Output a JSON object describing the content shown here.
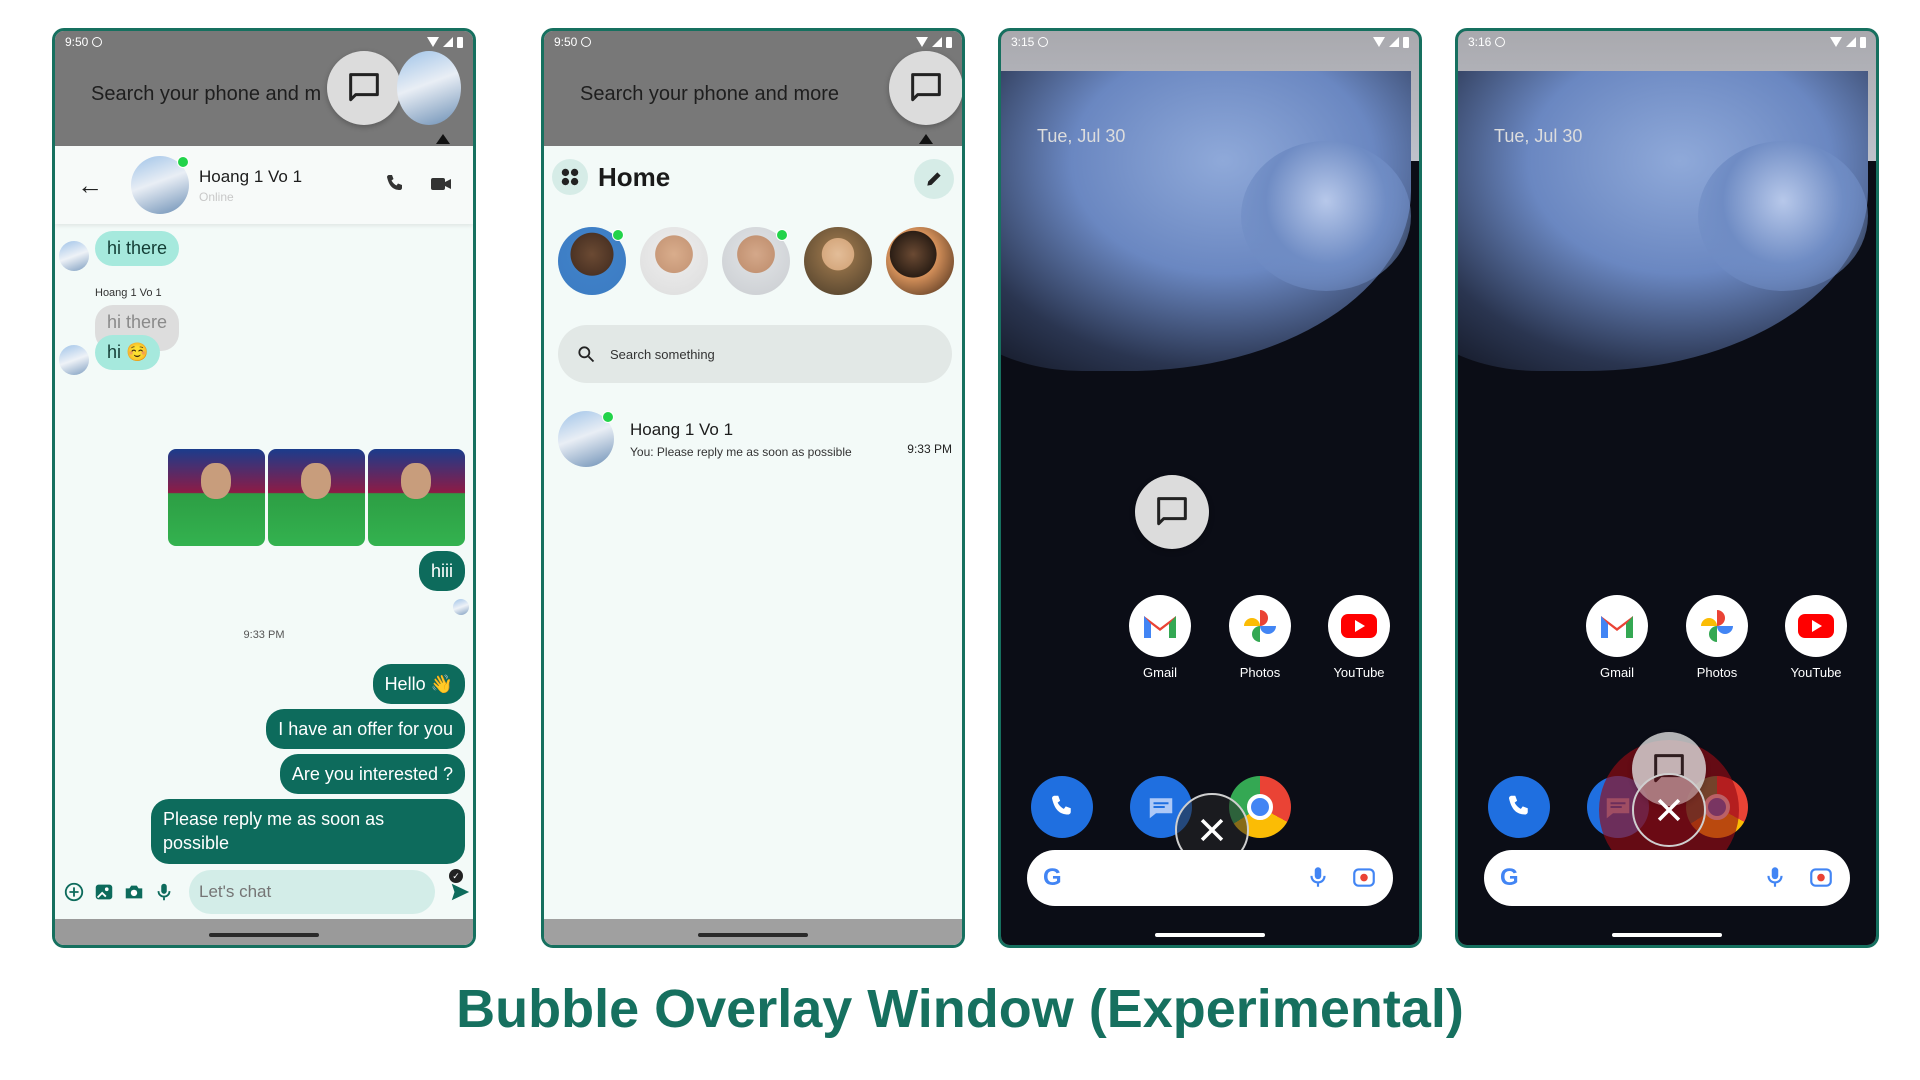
{
  "caption": "Bubble Overlay Window (Experimental)",
  "phone1": {
    "status_time": "9:50",
    "top_search": "Search your phone and m",
    "contact_name": "Hoang 1 Vo 1",
    "contact_status": "Online",
    "sender_label": "Hoang 1 Vo 1",
    "msg_hi_there_1": "hi there",
    "msg_hi_there_2": "hi there",
    "msg_hi": "hi ☺️",
    "msg_hiii": "hiii",
    "time_sep": "9:33 PM",
    "out_hello": "Hello 👋",
    "out_offer": "I have an offer for you",
    "out_interested": "Are you interested ?",
    "out_reply": "Please reply me as soon as possible",
    "composer_placeholder": "Let's chat"
  },
  "phone2": {
    "status_time": "9:50",
    "top_search": "Search your phone and more",
    "home_title": "Home",
    "search_placeholder": "Search something",
    "conv_name": "Hoang 1 Vo 1",
    "conv_preview": "You: Please reply me as soon as possible",
    "conv_time": "9:33 PM"
  },
  "phone3": {
    "status_time": "3:15",
    "date": "Tue, Jul 30",
    "apps": [
      {
        "label": "Gmail",
        "icon": "gmail-icon"
      },
      {
        "label": "Photos",
        "icon": "photos-icon"
      },
      {
        "label": "YouTube",
        "icon": "youtube-icon"
      }
    ]
  },
  "phone4": {
    "status_time": "3:16",
    "date": "Tue, Jul 30",
    "apps": [
      {
        "label": "Gmail",
        "icon": "gmail-icon"
      },
      {
        "label": "Photos",
        "icon": "photos-icon"
      },
      {
        "label": "YouTube",
        "icon": "youtube-icon"
      }
    ]
  },
  "colors": {
    "accent": "#16705f",
    "bubble_in": "#a6e9dd",
    "bubble_out": "#0d6b5c",
    "online": "#22d34a"
  }
}
